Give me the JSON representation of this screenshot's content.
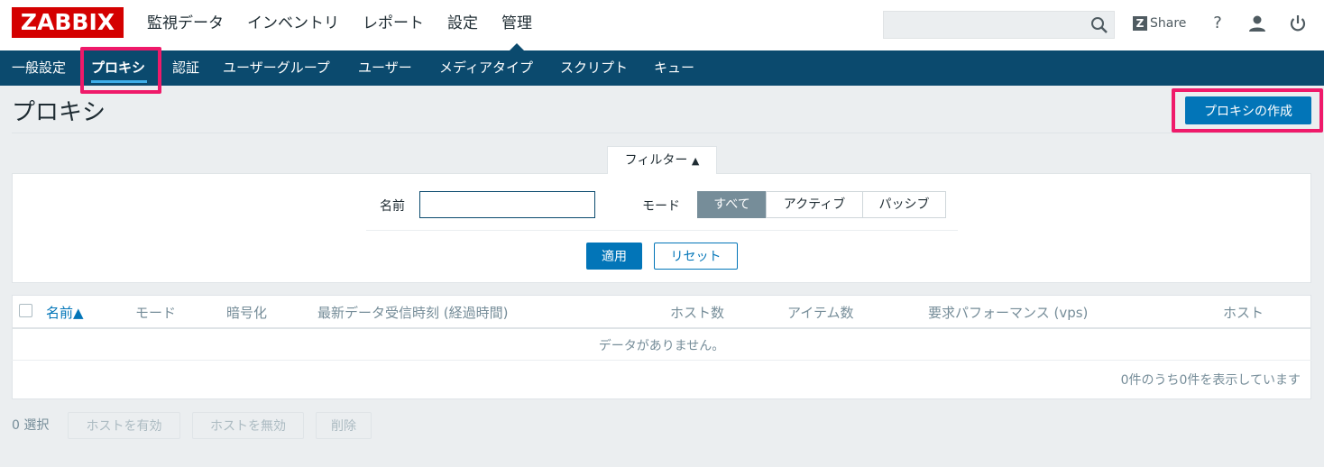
{
  "app": {
    "logo": "ZABBIX"
  },
  "topnav": {
    "items": [
      {
        "label": "監視データ"
      },
      {
        "label": "インベントリ"
      },
      {
        "label": "レポート"
      },
      {
        "label": "設定"
      },
      {
        "label": "管理"
      }
    ],
    "active": "管理",
    "share_label": "Share",
    "help_label": "?",
    "icons": [
      "search-icon",
      "share-icon",
      "help-icon",
      "user-icon",
      "power-icon"
    ]
  },
  "subnav": {
    "items": [
      {
        "label": "一般設定"
      },
      {
        "label": "プロキシ"
      },
      {
        "label": "認証"
      },
      {
        "label": "ユーザーグループ"
      },
      {
        "label": "ユーザー"
      },
      {
        "label": "メディアタイプ"
      },
      {
        "label": "スクリプト"
      },
      {
        "label": "キュー"
      }
    ],
    "active": "プロキシ"
  },
  "page": {
    "title": "プロキシ",
    "create_button": "プロキシの作成"
  },
  "filter": {
    "tab_label": "フィルター",
    "name_label": "名前",
    "name_value": "",
    "mode_label": "モード",
    "mode_options": [
      {
        "label": "すべて"
      },
      {
        "label": "アクティブ"
      },
      {
        "label": "パッシブ"
      }
    ],
    "mode_selected": "すべて",
    "apply_button": "適用",
    "reset_button": "リセット"
  },
  "table": {
    "columns": [
      {
        "label": "名前▲"
      },
      {
        "label": "モード"
      },
      {
        "label": "暗号化"
      },
      {
        "label": "最新データ受信時刻 (経過時間)"
      },
      {
        "label": "ホスト数"
      },
      {
        "label": "アイテム数"
      },
      {
        "label": "要求パフォーマンス (vps)"
      },
      {
        "label": "ホスト"
      }
    ],
    "empty_message": "データがありません。",
    "paging": "0件のうち0件を表示しています"
  },
  "actions": {
    "selected_count": "0 選択",
    "enable_hosts": "ホストを有効",
    "disable_hosts": "ホストを無効",
    "delete": "削除"
  },
  "colors": {
    "brand_red": "#d40000",
    "subnav_bg": "#0b4a6e",
    "primary_button": "#0275b8",
    "highlight_box": "#ef1a6a"
  }
}
